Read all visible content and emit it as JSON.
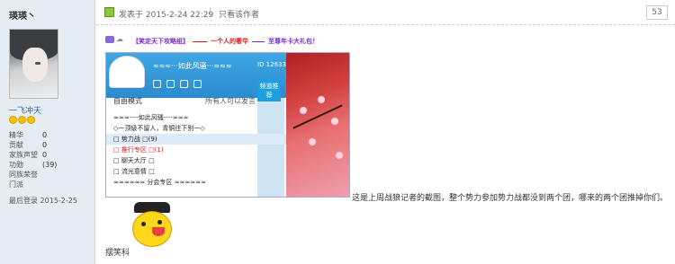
{
  "sidebar": {
    "username": "瑛瑛丶",
    "rank": "一飞冲天",
    "stats": [
      {
        "label": "精华",
        "value": "0"
      },
      {
        "label": "贡献",
        "value": "0"
      },
      {
        "label": "家族声望",
        "value": "0"
      },
      {
        "label": "功勋",
        "value": "(39)"
      },
      {
        "label": "同族荣誉",
        "value": ""
      },
      {
        "label": "门派",
        "value": ""
      }
    ],
    "reg_label": "最后登录",
    "reg_date": "2015-2-25"
  },
  "post": {
    "posted_at": "发表于 2015-2-24 22:29",
    "separator": "|",
    "only_author": "只看该作者",
    "floor": "53",
    "banner": {
      "left": "【笑定天下攻略组】",
      "mid": "一个人的奢华",
      "right": "至尊年卡大礼包！"
    },
    "caption": "这是上周战狼记者的截图，整个势力参加势力战都没到两个团，哪来的两个团推掉你们。",
    "emoji_label": "摆笑科"
  },
  "screenshot": {
    "title": "≈≈≈···如此风骚···≈≈≈",
    "id": "ID 12633943",
    "mode_left": "自由模式",
    "mode_right": "所有人可以发言",
    "badge": "频道推荐",
    "rows": [
      {
        "text": "≈≈≈----如此风骚----≈≈≈",
        "sel": false,
        "red": false
      },
      {
        "text": "◇一顶级不留人，青铜往下别一◇",
        "sel": false,
        "red": false
      },
      {
        "text": "□ 势力战 □(9)",
        "sel": true,
        "red": false
      },
      {
        "text": "□ 推行专区 □(1)",
        "sel": false,
        "red": true
      },
      {
        "text": "□ 聊天大厅 □",
        "sel": false,
        "red": false
      },
      {
        "text": "□ 流光意情 □",
        "sel": false,
        "red": false
      },
      {
        "text": "≈≈≈≈≈≈ 分会专区 ≈≈≈≈≈≈",
        "sel": false,
        "red": false
      }
    ]
  }
}
